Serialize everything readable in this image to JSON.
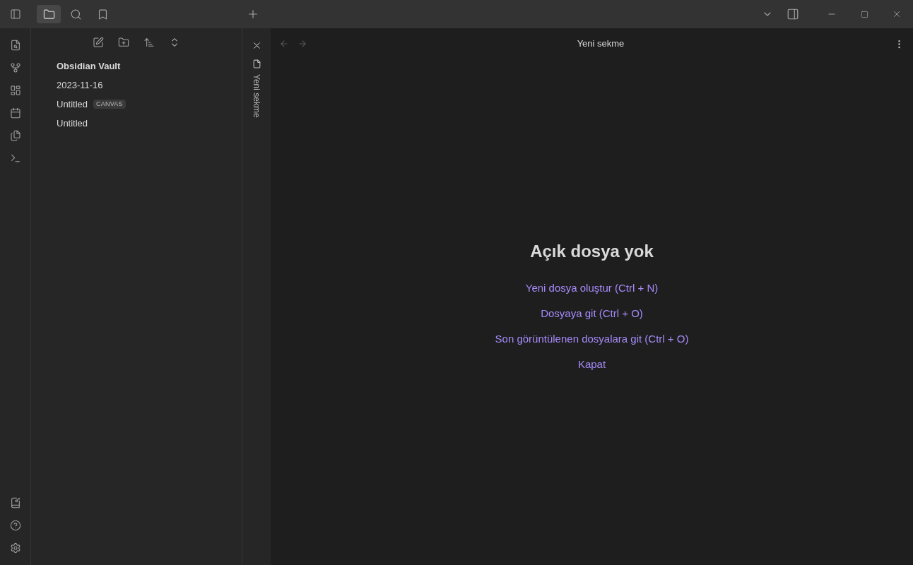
{
  "left_tabs": [
    {
      "kind": "files",
      "selected": true
    },
    {
      "kind": "search",
      "selected": false
    },
    {
      "kind": "bookmarks",
      "selected": false
    }
  ],
  "file_tree": {
    "root": "Obsidian Vault",
    "items": [
      {
        "label": "2023-11-16"
      },
      {
        "label": "Untitled",
        "badge": "CANVAS"
      },
      {
        "label": "Untitled"
      }
    ]
  },
  "vertical_tab": {
    "label": "Yeni sekme"
  },
  "view_header": {
    "title": "Yeni sekme",
    "back_disabled": true,
    "forward_disabled": true
  },
  "empty_state": {
    "title": "Açık dosya yok",
    "actions": [
      "Yeni dosya oluştur (Ctrl + N)",
      "Dosyaya git (Ctrl + O)",
      "Son görüntülenen dosyalara git (Ctrl + O)",
      "Kapat"
    ]
  }
}
